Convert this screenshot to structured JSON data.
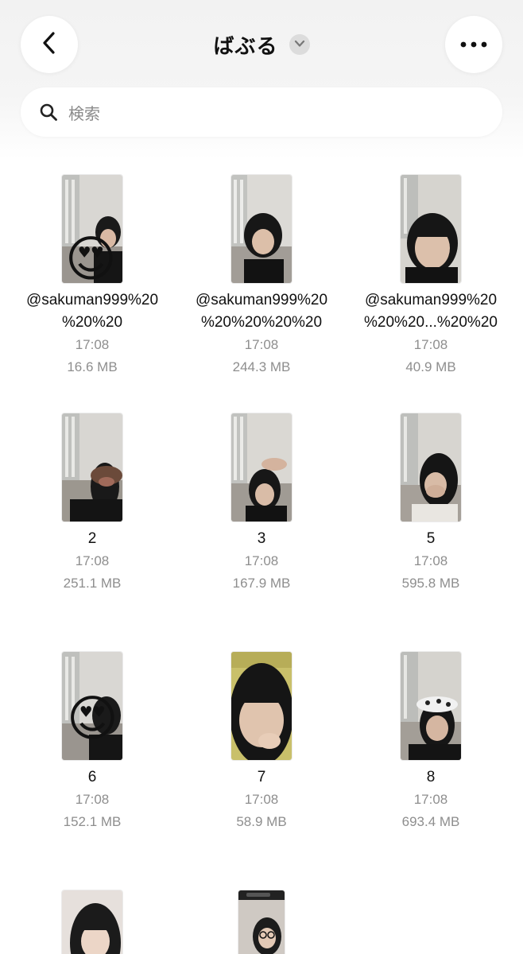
{
  "header": {
    "title": "ばぶる",
    "back_icon": "chevron-left-icon",
    "title_menu_icon": "chevron-down-icon",
    "more_icon": "ellipsis-icon"
  },
  "search": {
    "placeholder": "検索",
    "icon": "search-icon"
  },
  "files": [
    {
      "name": "@sakuman999%20\n%20%20",
      "time": "17:08",
      "size": "16.6 MB"
    },
    {
      "name": "@sakuman999%20\n%20%20%20%20",
      "time": "17:08",
      "size": "244.3 MB"
    },
    {
      "name": "@sakuman999%20\n%20%20...%20%20",
      "time": "17:08",
      "size": "40.9 MB"
    },
    {
      "name": "2",
      "time": "17:08",
      "size": "251.1 MB"
    },
    {
      "name": "3",
      "time": "17:08",
      "size": "167.9 MB"
    },
    {
      "name": "5",
      "time": "17:08",
      "size": "595.8 MB"
    },
    {
      "name": "6",
      "time": "17:08",
      "size": "152.1 MB"
    },
    {
      "name": "7",
      "time": "17:08",
      "size": "58.9 MB"
    },
    {
      "name": "8",
      "time": "17:08",
      "size": "693.4 MB"
    },
    {
      "name": "",
      "time": "",
      "size": ""
    },
    {
      "name": "",
      "time": "",
      "size": ""
    }
  ],
  "emoji": "😍"
}
